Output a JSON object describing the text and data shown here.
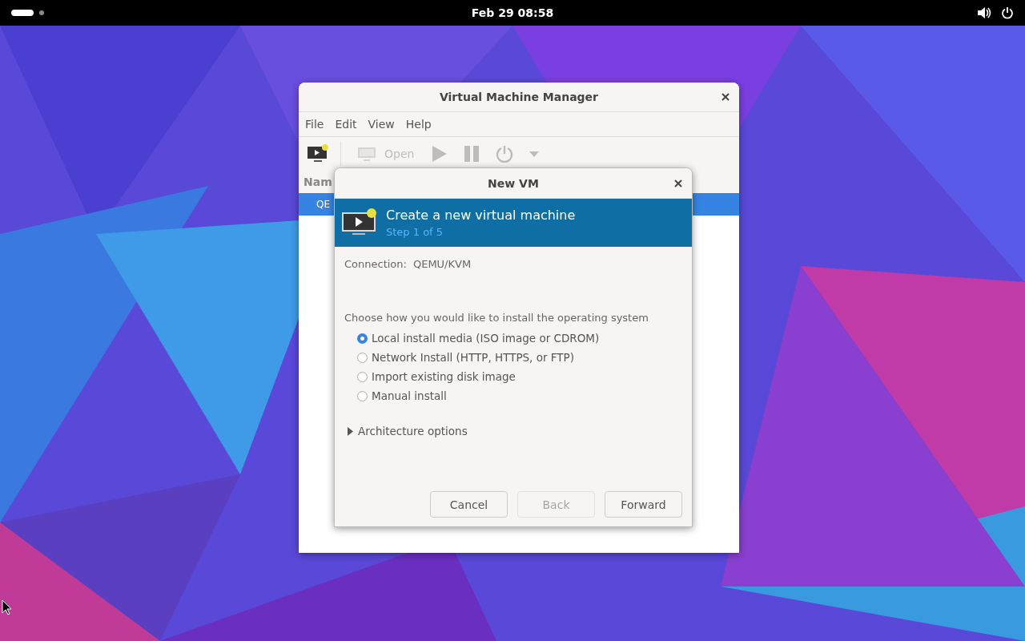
{
  "top_bar": {
    "clock": "Feb 29  08:58"
  },
  "main_window": {
    "title": "Virtual Machine Manager",
    "menu": [
      "File",
      "Edit",
      "View",
      "Help"
    ],
    "toolbar": [
      {
        "kind": "new",
        "disabled": false
      },
      {
        "kind": "open",
        "label": "Open",
        "disabled": true
      },
      {
        "kind": "run",
        "disabled": true
      },
      {
        "kind": "pause",
        "disabled": true
      },
      {
        "kind": "power",
        "disabled": true
      },
      {
        "kind": "dropdown",
        "disabled": true
      }
    ],
    "list": {
      "column": "Nam",
      "rows": [
        {
          "name": "QE",
          "selected": true
        }
      ]
    }
  },
  "dialog": {
    "title": "New VM",
    "header": {
      "title": "Create a new virtual machine",
      "subtitle": "Step 1 of 5"
    },
    "connection_label": "Connection:",
    "connection": "QEMU/KVM",
    "prompt": "Choose how you would like to install the operating system",
    "options": [
      {
        "label": "Local install media (ISO image or CDROM)",
        "selected": true
      },
      {
        "label": "Network Install (HTTP, HTTPS, or FTP)",
        "selected": false
      },
      {
        "label": "Import existing disk image",
        "selected": false
      },
      {
        "label": "Manual install",
        "selected": false
      }
    ],
    "expander": {
      "label": "Architecture options",
      "expanded": false
    },
    "buttons": [
      {
        "label": "Cancel",
        "disabled": false
      },
      {
        "label": "Back",
        "disabled": true
      },
      {
        "label": "Forward",
        "disabled": false
      }
    ]
  }
}
